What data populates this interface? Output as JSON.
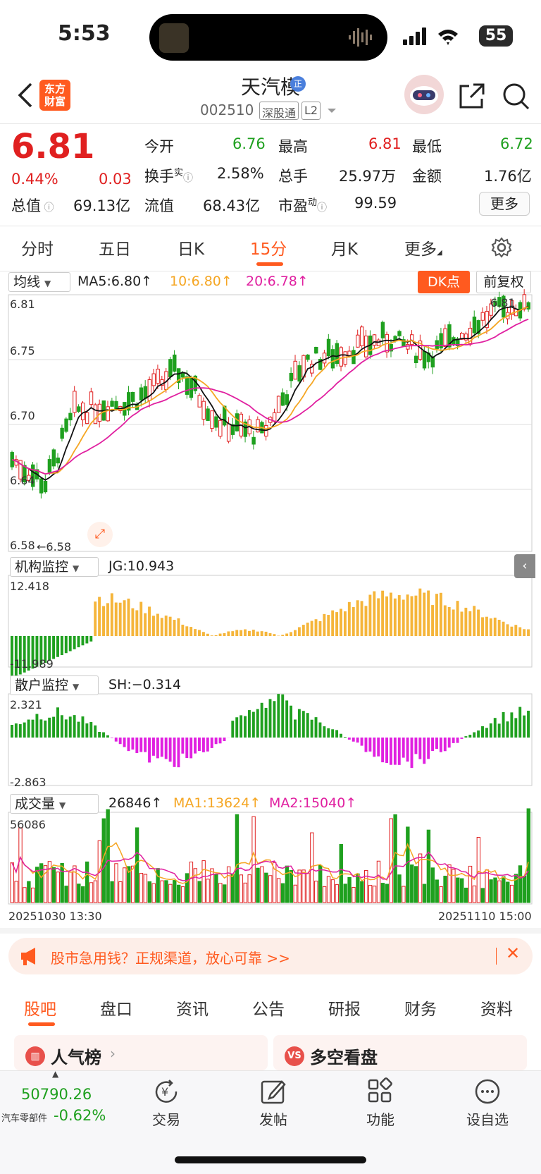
{
  "status": {
    "time": "5:53",
    "battery": "55"
  },
  "header": {
    "logo_line1": "东方",
    "logo_line2": "财富",
    "stock_name": "天汽模",
    "badge": "正",
    "code": "002510",
    "tag1": "深股通",
    "tag2": "L2"
  },
  "quote": {
    "price": "6.81",
    "change_pct": "0.44%",
    "change": "0.03",
    "open_label": "今开",
    "open": "6.76",
    "high_label": "最高",
    "high": "6.81",
    "low_label": "最低",
    "low": "6.72",
    "turnover_label": "换手",
    "turnover_sup": "实",
    "turnover": "2.58%",
    "volume_label": "总手",
    "volume": "25.97万",
    "amount_label": "金额",
    "amount": "1.76亿",
    "mktcap_label": "总值",
    "mktcap": "69.13亿",
    "float_label": "流值",
    "float_cap": "68.43亿",
    "pe_label": "市盈",
    "pe_sup": "动",
    "pe": "99.59",
    "more": "更多"
  },
  "period_tabs": [
    "分时",
    "五日",
    "日K",
    "15分",
    "月K",
    "更多"
  ],
  "active_period": "15分",
  "main_chart": {
    "indicator_select": "均线",
    "ma5": "MA5:6.80↑",
    "ma10": "10:6.80↑",
    "ma20": "20:6.78↑",
    "dk_button": "DK点",
    "adjust_button": "前复权",
    "y_labels": [
      "6.81",
      "6.75",
      "6.70",
      "6.64",
      "6.58"
    ],
    "max_label": "6.81",
    "min_label": "←6.58"
  },
  "jg": {
    "select": "机构监控",
    "value": "JG:10.943",
    "max": "12.418",
    "min": "-11.989"
  },
  "sh": {
    "select": "散户监控",
    "value": "SH:−0.314",
    "max": "2.321",
    "min": "-2.863"
  },
  "vol": {
    "select": "成交量",
    "value": "26846↑",
    "ma1": "MA1:13624↑",
    "ma2": "MA2:15040↑",
    "max": "56086",
    "start": "20251030 13:30",
    "end": "20251110 15:00"
  },
  "banner": {
    "text": "股市急用钱？正规渠道，放心可靠 >>"
  },
  "bottom_tabs": [
    "股吧",
    "盘口",
    "资讯",
    "公告",
    "研报",
    "财务",
    "资料"
  ],
  "cards": {
    "left": "人气榜",
    "right": "多空看盘"
  },
  "footer": {
    "index_value": "50790.26",
    "index_name": "汽车零部件",
    "index_change": "-0.62%",
    "trade": "交易",
    "post": "发帖",
    "func": "功能",
    "watch": "设自选"
  },
  "colors": {
    "up": "#e02020",
    "down": "#1fa01f",
    "accent": "#ff5a1f",
    "ma10": "#f5a623",
    "ma20": "#e020a0"
  }
}
